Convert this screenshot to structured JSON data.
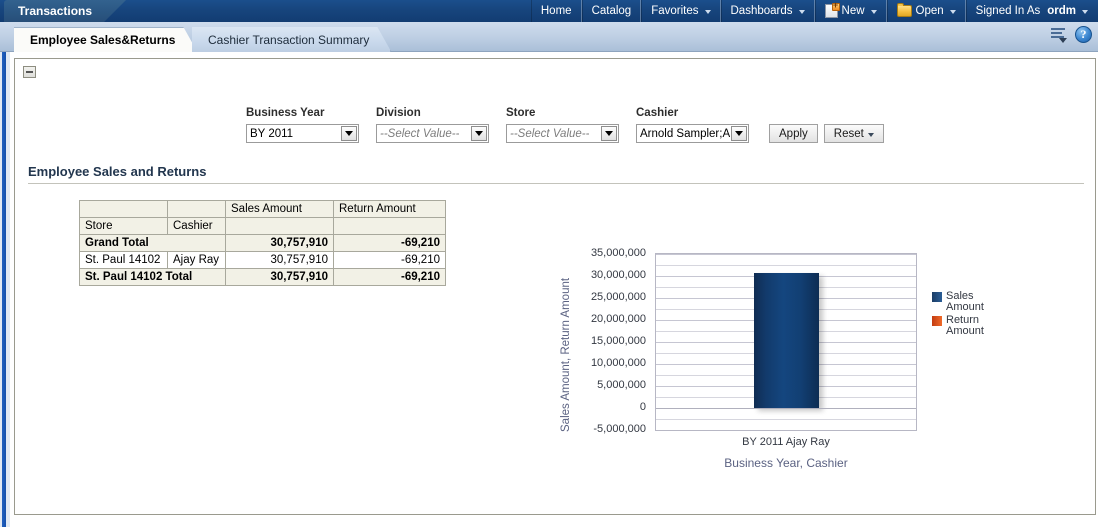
{
  "topbar": {
    "app_tab": "Transactions",
    "nav": [
      {
        "label": "Home",
        "icon": null,
        "has_caret": false
      },
      {
        "label": "Catalog",
        "icon": null,
        "has_caret": false
      },
      {
        "label": "Favorites",
        "icon": null,
        "has_caret": true
      },
      {
        "label": "Dashboards",
        "icon": null,
        "has_caret": true
      },
      {
        "label": "New",
        "icon": "new-document-icon",
        "has_caret": true
      },
      {
        "label": "Open",
        "icon": "folder-open-icon",
        "has_caret": true
      }
    ],
    "signed_in_as_label": "Signed In As",
    "user": "ordm"
  },
  "tabs": [
    {
      "label": "Employee Sales&Returns",
      "active": true
    },
    {
      "label": "Cashier Transaction Summary",
      "active": false
    }
  ],
  "tabstrip_icons": {
    "page_options": "page-options-icon",
    "help": "?"
  },
  "panel": {
    "collapse_icon": "collapse-minus-icon"
  },
  "prompts": {
    "fields": [
      {
        "label": "Business Year",
        "value": "BY 2011",
        "is_placeholder": false
      },
      {
        "label": "Division",
        "value": "--Select Value--",
        "is_placeholder": true
      },
      {
        "label": "Store",
        "value": "--Select Value--",
        "is_placeholder": true
      },
      {
        "label": "Cashier",
        "value": "Arnold Sampler;A",
        "is_placeholder": false
      }
    ],
    "apply_label": "Apply",
    "reset_label": "Reset"
  },
  "report": {
    "title": "Employee Sales and Returns"
  },
  "table": {
    "measure_headers": [
      "Sales Amount",
      "Return Amount"
    ],
    "dim_headers": [
      "Store",
      "Cashier"
    ],
    "rows": [
      {
        "type": "total",
        "label": "Grand Total",
        "span": true,
        "store": "Grand Total",
        "cashier": "",
        "sales": "30,757,910",
        "return": "-69,210"
      },
      {
        "type": "data",
        "span": false,
        "store": "St. Paul 14102",
        "cashier": "Ajay Ray",
        "sales": "30,757,910",
        "return": "-69,210"
      },
      {
        "type": "total",
        "label": "St. Paul 14102 Total",
        "span": true,
        "store": "St. Paul 14102 Total",
        "cashier": "",
        "sales": "30,757,910",
        "return": "-69,210"
      }
    ]
  },
  "chart_data": {
    "type": "bar",
    "title": "",
    "categories": [
      "BY 2011 Ajay Ray"
    ],
    "series": [
      {
        "name": "Sales Amount",
        "values": [
          30757910
        ],
        "color": "#14467f"
      },
      {
        "name": "Return Amount",
        "values": [
          -69210
        ],
        "color": "#d94f18"
      }
    ],
    "xlabel": "Business Year, Cashier",
    "ylabel": "Sales Amount, Return Amount",
    "ylim": [
      -5000000,
      35000000
    ],
    "ytick_values": [
      35000000,
      30000000,
      25000000,
      20000000,
      15000000,
      10000000,
      5000000,
      0,
      -5000000
    ],
    "ytick_labels": [
      "35,000,000",
      "30,000,000",
      "25,000,000",
      "20,000,000",
      "15,000,000",
      "10,000,000",
      "5,000,000",
      "0",
      "-5,000,000"
    ],
    "minor_gridline_step": 2500000,
    "grid": true,
    "legend_position": "right",
    "legend_entries": [
      "Sales Amount",
      "Return Amount"
    ]
  }
}
